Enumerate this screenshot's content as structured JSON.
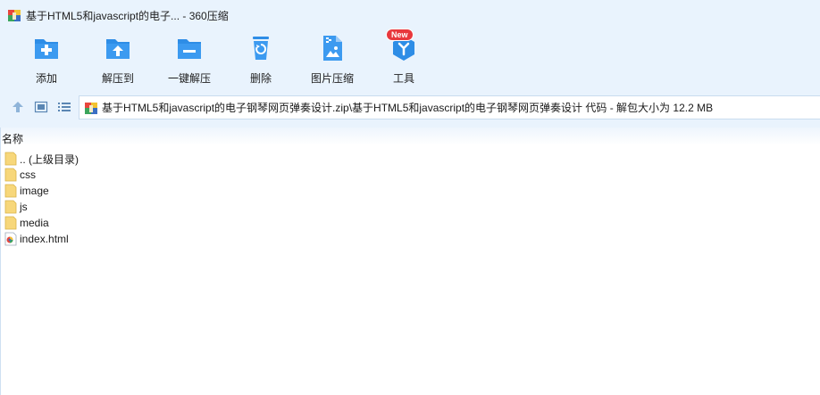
{
  "window": {
    "title": "基于HTML5和javascript的电子... - 360压缩"
  },
  "toolbar": {
    "items": [
      {
        "label": "添加",
        "icon": "add-file-icon"
      },
      {
        "label": "解压到",
        "icon": "extract-to-icon"
      },
      {
        "label": "一键解压",
        "icon": "one-click-extract-icon"
      },
      {
        "label": "删除",
        "icon": "delete-icon"
      },
      {
        "label": "图片压缩",
        "icon": "image-compress-icon"
      },
      {
        "label": "工具",
        "icon": "tools-icon",
        "badge": "New"
      }
    ]
  },
  "address": {
    "path": "基于HTML5和javascript的电子钢琴网页弹奏设计.zip\\基于HTML5和javascript的电子钢琴网页弹奏设计 代码 - 解包大小为 12.2 MB"
  },
  "file_list": {
    "column_header": "名称",
    "items": [
      {
        "name": ".. (上级目录)",
        "type": "folder"
      },
      {
        "name": "css",
        "type": "folder"
      },
      {
        "name": "image",
        "type": "folder"
      },
      {
        "name": "js",
        "type": "folder"
      },
      {
        "name": "media",
        "type": "folder"
      },
      {
        "name": "index.html",
        "type": "html"
      }
    ]
  },
  "colors": {
    "chrome_bg": "#e9f3fd",
    "icon_blue": "#2e8de6",
    "badge_red": "#e8383d"
  }
}
